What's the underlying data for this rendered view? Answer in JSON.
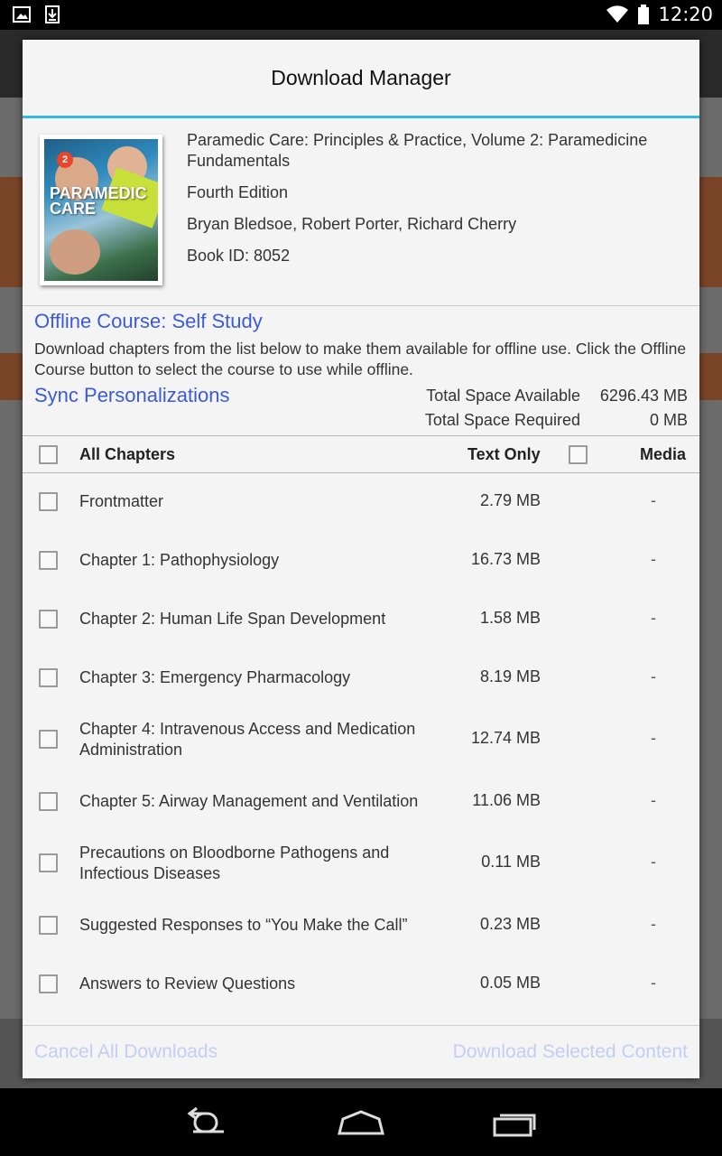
{
  "status_bar": {
    "time": "12:20"
  },
  "dialog": {
    "title": "Download Manager",
    "book": {
      "cover_title": "PARAMEDIC CARE",
      "cover_badge": "2",
      "title": "Paramedic Care: Principles & Practice, Volume 2: Paramedicine Fundamentals",
      "edition": "Fourth Edition",
      "authors": "Bryan Bledsoe, Robert Porter, Richard Cherry",
      "book_id": "Book ID: 8052"
    },
    "offline": {
      "course_link": "Offline Course: Self Study",
      "description": "Download chapters from the list below to make them available for offline use. Click the Offline Course button to select the course to use while offline.",
      "sync_link": "Sync Personalizations",
      "space_available_label": "Total Space Available",
      "space_available_value": "6296.43 MB",
      "space_required_label": "Total Space Required",
      "space_required_value": "0 MB"
    },
    "columns": {
      "all_chapters": "All Chapters",
      "text_only": "Text Only",
      "media": "Media"
    },
    "chapters": [
      {
        "name": "Frontmatter",
        "size": "2.79 MB",
        "media": "-"
      },
      {
        "name": "Chapter 1: Pathophysiology",
        "size": "16.73 MB",
        "media": "-"
      },
      {
        "name": "Chapter 2: Human Life Span Development",
        "size": "1.58 MB",
        "media": "-"
      },
      {
        "name": "Chapter 3: Emergency Pharmacology",
        "size": "8.19 MB",
        "media": "-"
      },
      {
        "name": "Chapter 4: Intravenous Access and Medication Administration",
        "size": "12.74 MB",
        "media": "-"
      },
      {
        "name": "Chapter 5: Airway Management and Ventilation",
        "size": "11.06 MB",
        "media": "-"
      },
      {
        "name": "Precautions on Bloodborne Pathogens and Infectious Diseases",
        "size": "0.11 MB",
        "media": "-"
      },
      {
        "name": "Suggested Responses to “You Make the Call”",
        "size": "0.23 MB",
        "media": "-"
      },
      {
        "name": "Answers to Review Questions",
        "size": "0.05 MB",
        "media": "-"
      }
    ],
    "footer": {
      "cancel_label": "Cancel All Downloads",
      "download_label": "Download Selected Content"
    }
  },
  "colors": {
    "accent": "#33b5e5",
    "link": "#3b5bdb",
    "disabled_button": "#c6cdf2"
  }
}
